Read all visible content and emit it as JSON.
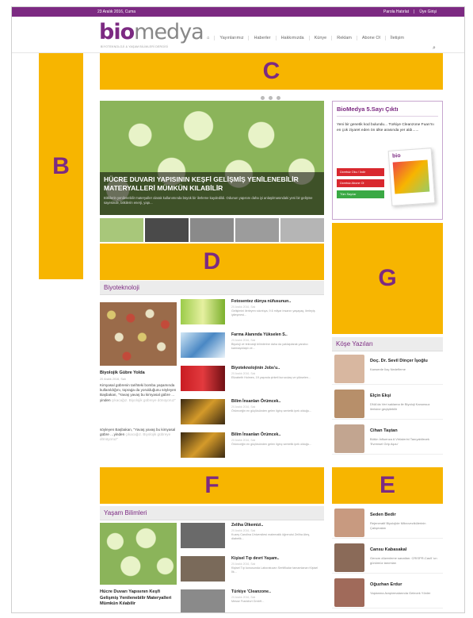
{
  "topbar": {
    "date": "23 Aralık 2016, Cuma",
    "links": [
      "Parola Hatırlat",
      "Üye Girişi"
    ]
  },
  "brand": {
    "logo_bio": "bio",
    "logo_rest": "medya",
    "tagline": "BİYOTEKNOLOJİ & YAŞAM BİLİMLERİ DERGİSİ"
  },
  "nav": [
    "Yayınlarımız",
    "Haberler",
    "Hakkımızda",
    "Künye",
    "Reklam",
    "Abone Ol",
    "İletişim"
  ],
  "ads": {
    "A": "B",
    "C": "C",
    "D": "D",
    "E": "E",
    "F": "F",
    "G": "G"
  },
  "hero": {
    "title": "HÜCRE DUVARI YAPISININ KEŞFİ GELİŞMİŞ YENİLENEBİLİR MATERYALLERİ MÜMKÜN KILABİLİR",
    "desc": "Bitkilerin yenilenebilir materyaller olarak kullanımında büyük bir ilerleme kaydedildi. Odunun yapısını daha iyi anlaşılmasındaki yeni bir gelişme sayesinde, bitkilerin enerji, yapı..."
  },
  "biyoteknoloji": {
    "heading": "Biyoteknoloji",
    "feature": {
      "title": "Biyolojik Gübre Yolda",
      "meta": "20 Aralık 2016, Salı",
      "p1": "Kimyasal gübrenin tarihteki bomba yaşamında kullanıldığını, topraģa da yorulduğunu söyleyen Başbakan, \"Yavaş yavaş bu kimyasal gübre …yinden",
      "p1_faded": "çıkacağız. Biyolojik gübreye dönüyoruz\"",
      "p2": "söyleyen Başbakan, \"Yavaş yavaş bu kimyasal gübre …yinden",
      "p2_faded": "çıkacağız. Biyolojik gübreye dönüyoruz\""
    },
    "items": [
      {
        "title": "Fotosentez dünya nüfusunun..",
        "meta": "20 Aralık 2016, Salı",
        "desc": "Gelişimini ilerleyen sıkıntıya, 9.6 milyar insanın yaşayaq, ilerleyiş iyileşmesi..."
      },
      {
        "title": "Farma Alanında Yükselen S..",
        "meta": "20 Aralık 2016, Salı",
        "desc": "Biyoloji ve teknoloji bilimlerine daha da yaklaşılarak yaratıcı karmaşıklaştı ve..."
      },
      {
        "title": "Biyoteknolojinin Jobs'u..",
        "meta": "20 Aralık 2016, Salı",
        "desc": "Elizabeth Holmes, 19 yaşında şirketi kuruculaq ve yükselen..."
      },
      {
        "title": "Bilim İnsanları Örümcek..",
        "meta": "20 Aralık 2016, Salı",
        "desc": "Örümceğin en güçlüsünden gelen ilginç sentetik ipek olduğu..."
      },
      {
        "title": "Bilim İnsanları Örümcek..",
        "meta": "20 Aralık 2016, Salı",
        "desc": "Örümceğin en güçlüsünden gelen ilginç sentetik ipek olduğu..."
      }
    ]
  },
  "promo": {
    "title": "BioMedya 5.Sayı Çıktı",
    "text": "Yeni bir genetik kod bulundu... Türkiye Cleanzone Fuarı'nı en çok ziyaret eden ön ülke arasında yer aldı......",
    "buttons": [
      "Ücretsiz Oku / İndir",
      "Ücretsiz Abone Ol",
      "Tüm Sayılar"
    ],
    "button_colors": [
      "#d9282f",
      "#d9282f",
      "#3aa944"
    ],
    "mag_logo": "bio"
  },
  "kose": {
    "heading": "Köşe Yazıları",
    "people": [
      {
        "name": "Doç. Dr. Sevil Dinçer İşoğlu",
        "sub": "Kanserde İlaç Nedefleme"
      },
      {
        "name": "Elçin Ekşi",
        "sub": "DNA'da Veri saklama ile Biyoloji Kanunsuz ilerisine geçişilebilir"
      },
      {
        "name": "Cihan Taştan",
        "sub": "Bütün İnfluenza A Virüslerini Tanıyabilecek 'Evrensel Grip Aşısı'"
      }
    ]
  },
  "yasam": {
    "heading": "Yaşam Bilimleri",
    "feature_title": "Hücre Duvarı Yapısının Keşfi Gelişmiş Yenilenebilir Materyalleri Mümkün Kılabilir",
    "items": [
      {
        "title": "Zeliha Ülkemizi..",
        "meta": "20 Aralık 2016, Salı",
        "desc": "Kuzey Carolina Üniversitesi matematik öğrencisi Zeliha Ateş, diabetik..."
      },
      {
        "title": "Kişisel Tıp devri Yaşam..",
        "meta": "20 Aralık 2016, Salı",
        "desc": "Kişisel Tıp konusunda Laboratuvarı Sertifikalar tamamlanan Kişisel İlk..."
      },
      {
        "title": "Türkiye 'Cleanzone..",
        "meta": "20 Aralık 2016, Salı",
        "desc": "Messe Frankfurt GmbH..."
      }
    ]
  },
  "kose2": {
    "people": [
      {
        "name": "Seden Bedir",
        "sub": "Rejeneratif Biyolojide Mikrovezikülerinin Çalışmaları"
      },
      {
        "name": "Cansu Kabasakal",
        "sub": "Genom düzenleme sanatları: CRISPR-Cas9 'un günümüz tanımları"
      },
      {
        "name": "Oğuzhan Erdur",
        "sub": "Yaşlanma Araştırmalarında Gelecek Yönler"
      }
    ]
  }
}
